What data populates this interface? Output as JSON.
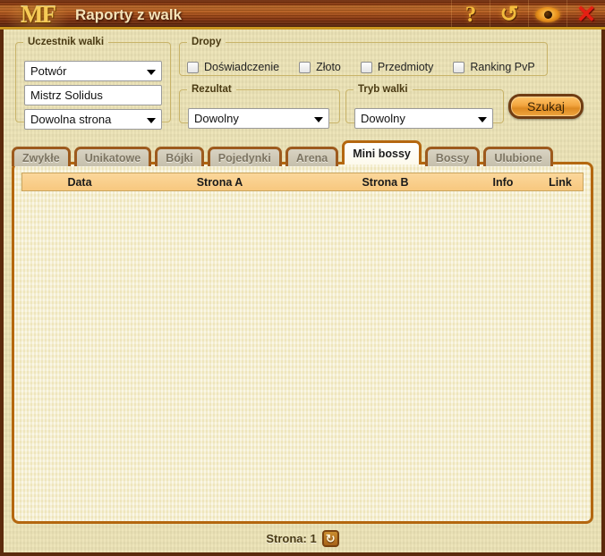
{
  "window": {
    "logo": "MF",
    "title": "Raporty z walk",
    "icons": [
      {
        "name": "help-icon",
        "glyph": "?"
      },
      {
        "name": "refresh-icon",
        "glyph": "↺"
      },
      {
        "name": "eye-icon",
        "glyph": ""
      },
      {
        "name": "close-icon",
        "glyph": "✕"
      }
    ]
  },
  "form": {
    "participant": {
      "legend": "Uczestnik walki",
      "type_value": "Potwór",
      "name_value": "Mistrz Solidus",
      "side_value": "Dowolna strona"
    },
    "drops": {
      "legend": "Dropy",
      "items": [
        {
          "label": "Doświadczenie",
          "checked": false
        },
        {
          "label": "Złoto",
          "checked": false
        },
        {
          "label": "Przedmioty",
          "checked": false
        },
        {
          "label": "Ranking PvP",
          "checked": false
        }
      ]
    },
    "result": {
      "legend": "Rezultat",
      "value": "Dowolny"
    },
    "mode": {
      "legend": "Tryb walki",
      "value": "Dowolny"
    },
    "search_button": "Szukaj"
  },
  "tabs": [
    {
      "label": "Zwykłe",
      "active": false
    },
    {
      "label": "Unikatowe",
      "active": false
    },
    {
      "label": "Bójki",
      "active": false
    },
    {
      "label": "Pojedynki",
      "active": false
    },
    {
      "label": "Arena",
      "active": false
    },
    {
      "label": "Mini bossy",
      "active": true
    },
    {
      "label": "Bossy",
      "active": false
    },
    {
      "label": "Ulubione",
      "active": false
    }
  ],
  "table": {
    "columns": [
      "Data",
      "Strona A",
      "Strona B",
      "Info",
      "Link"
    ],
    "rows": []
  },
  "footer": {
    "page_label": "Strona: 1",
    "refresh_glyph": "↻"
  },
  "colors": {
    "titlebar_brown": "#8d3a0e",
    "gold_accent": "#c9951f",
    "panel_border": "#b4670f",
    "panel_bg": "#f6efcf",
    "table_header": "#f8c87f",
    "page_bg": "#ece3b6",
    "close_red": "#e61f13",
    "button_orange": "#f3a53f"
  }
}
